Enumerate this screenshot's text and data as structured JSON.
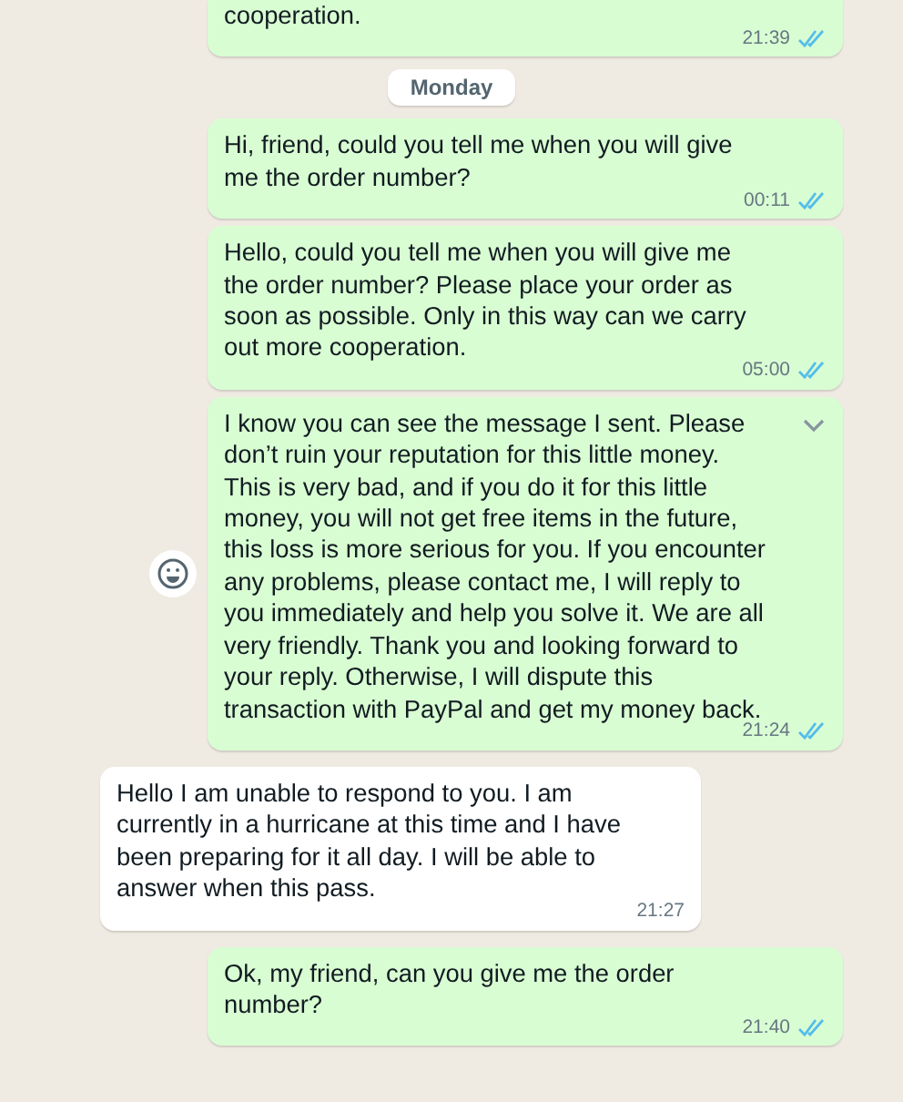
{
  "messages": [
    {
      "kind": "out",
      "text": "cooperation.",
      "time": "21:39",
      "read": true,
      "hovered": false
    },
    {
      "kind": "date",
      "text": "Monday"
    },
    {
      "kind": "out",
      "text": "Hi, friend, could you tell me when you will give me the order number?",
      "time": "00:11",
      "read": true,
      "hovered": false
    },
    {
      "kind": "out",
      "text": "Hello, could you tell me when you will give me the order number? Please place your order as soon as possible. Only in this way can we carry out more cooperation.",
      "time": "05:00",
      "read": true,
      "hovered": false
    },
    {
      "kind": "out",
      "text": "I know you can see the message I sent. Please don’t ruin your reputation for this little money. This is very bad, and if you do it for this little money, you will not get free items in the future, this loss is more serious for you. If you encounter any problems, please contact me, I will reply to you immediately and help you solve it. We are all very friendly. Thank you and looking forward to your reply. Otherwise, I will dispute this transaction with PayPal and get my money back.",
      "time": "21:24",
      "read": true,
      "hovered": true
    },
    {
      "kind": "in",
      "text": "Hello I am unable to respond to you. I am currently in a hurricane at this time and I have been preparing for it all day. I will be able to answer when this pass.",
      "time": "21:27",
      "hovered": false
    },
    {
      "kind": "out",
      "text": "Ok, my friend, can you give me the order number?",
      "time": "21:40",
      "read": true,
      "hovered": false
    }
  ]
}
